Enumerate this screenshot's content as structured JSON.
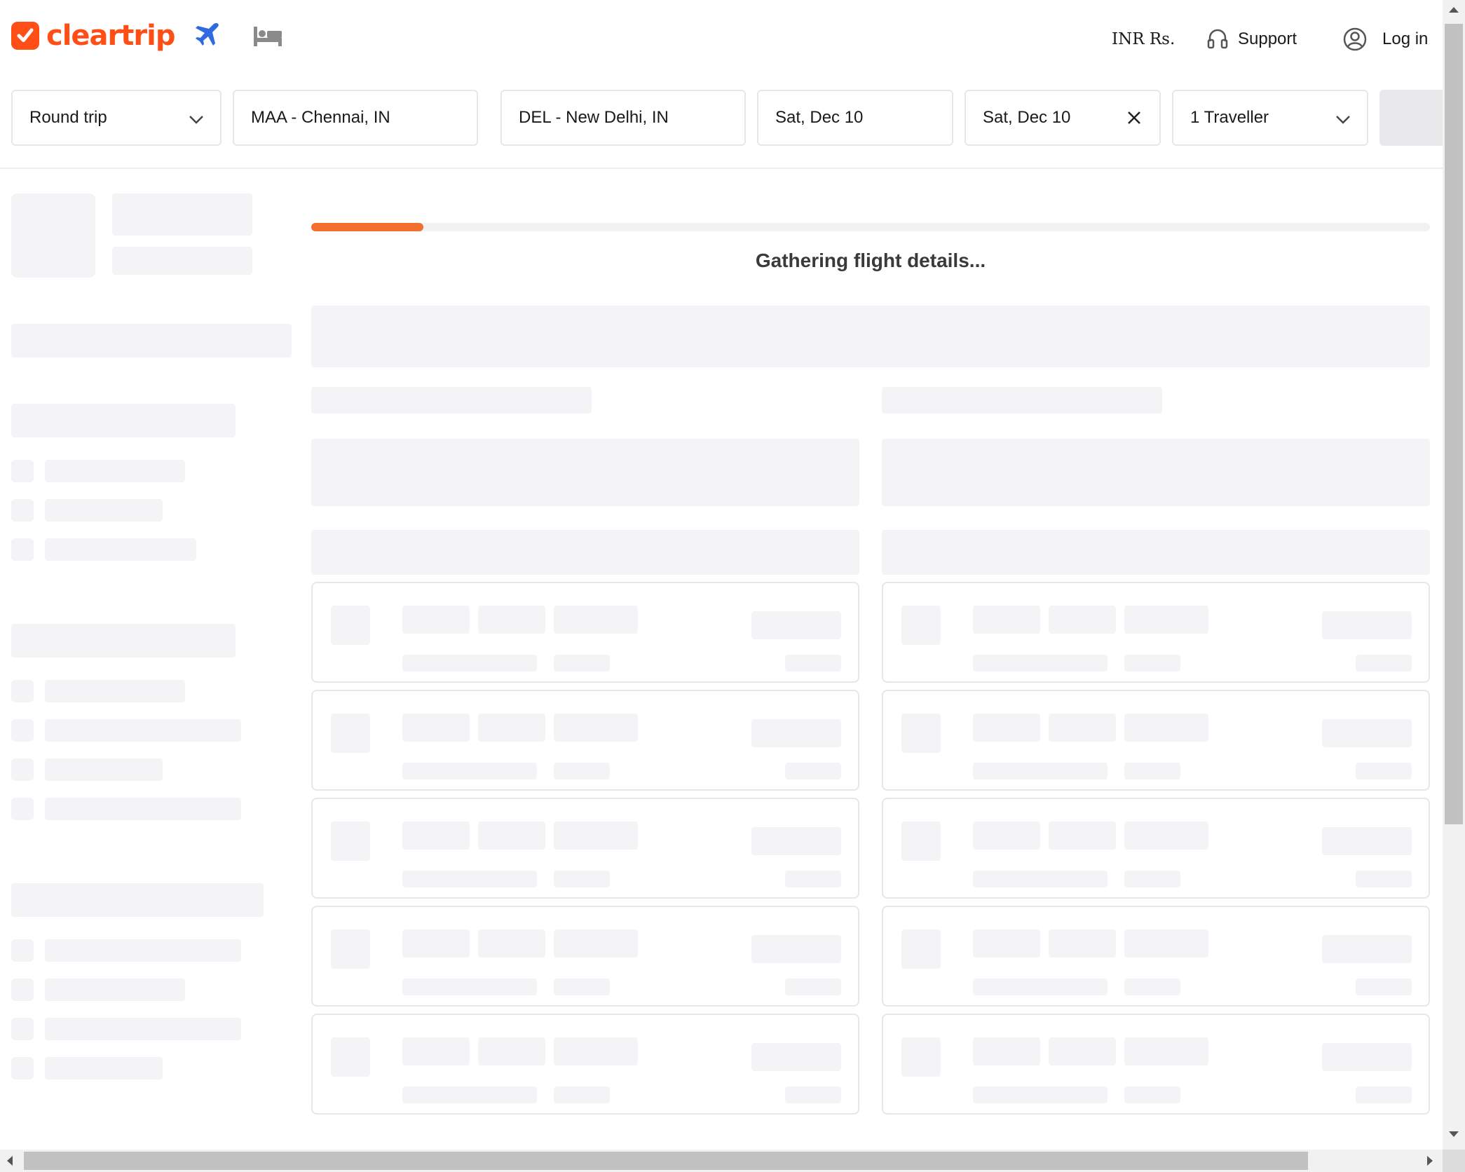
{
  "brand": {
    "name": "cleartrip",
    "color": "#ff4f17"
  },
  "header": {
    "nav": [
      {
        "name": "flights",
        "icon": "airplane-icon",
        "color": "#2f6ae0"
      },
      {
        "name": "hotels",
        "icon": "bed-icon",
        "color": "#8a8a8a"
      }
    ],
    "currency": "INR Rs.",
    "support": {
      "label": "Support",
      "icon": "headset-icon"
    },
    "login": {
      "label": "Log in",
      "icon": "user-circle-icon"
    }
  },
  "search": {
    "trip_type": "Round trip",
    "from": "MAA - Chennai, IN",
    "to": "DEL - New Delhi, IN",
    "depart": "Sat, Dec 10",
    "return": "Sat, Dec 10",
    "travellers": "1 Traveller"
  },
  "loading": {
    "message": "Gathering flight details...",
    "progress_percent": 10,
    "accent": "#f26f2d"
  }
}
